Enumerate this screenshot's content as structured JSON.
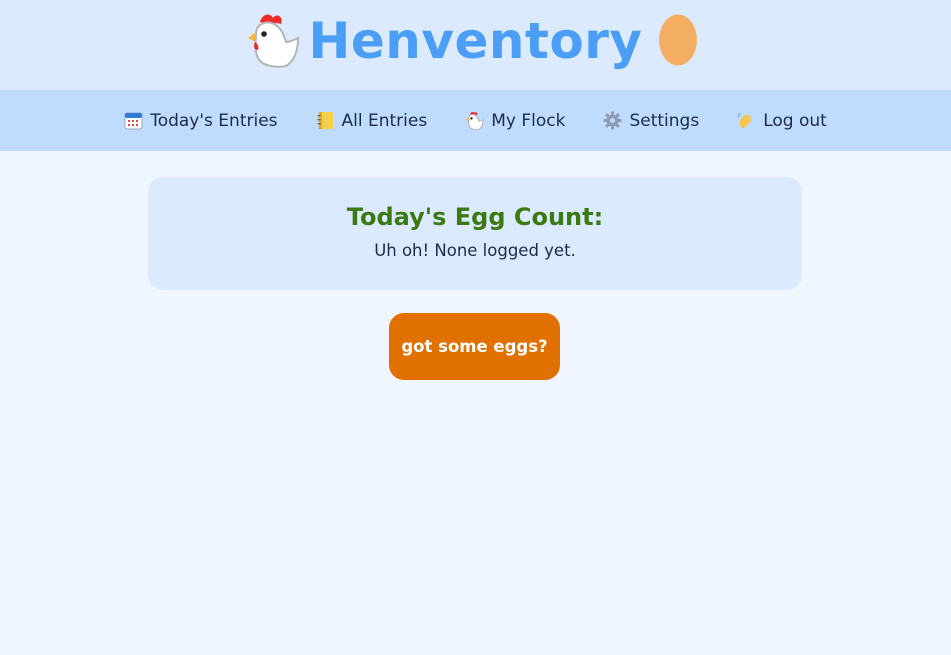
{
  "header": {
    "title": "Henventory",
    "logo_icons": [
      "chicken-icon",
      "egg-icon"
    ]
  },
  "nav": {
    "items": [
      {
        "label": "Today's Entries",
        "icon": "calendar-icon"
      },
      {
        "label": "All Entries",
        "icon": "notebook-icon"
      },
      {
        "label": "My Flock",
        "icon": "chicken-icon"
      },
      {
        "label": "Settings",
        "icon": "gear-icon"
      },
      {
        "label": "Log out",
        "icon": "waving-hand-icon"
      }
    ]
  },
  "egg_count": {
    "title": "Today's Egg Count:",
    "message": "Uh oh! None logged yet."
  },
  "cta": {
    "label": "got some eggs?"
  },
  "colors": {
    "page_bg": "#eff6ff",
    "header_bg": "#dbeafe",
    "nav_bg": "#bfdbfe",
    "title": "#4a9ef5",
    "egg_count_title": "#3b7a12",
    "button": "#e07000"
  }
}
